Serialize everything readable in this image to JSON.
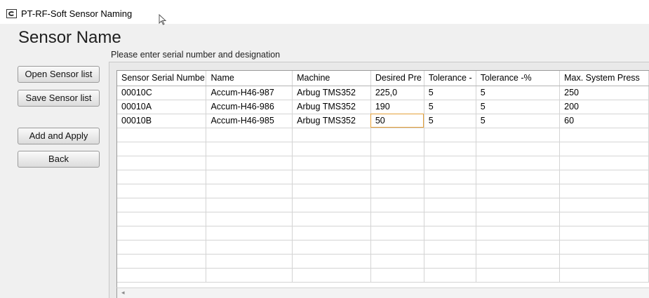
{
  "window": {
    "title": "PT-RF-Soft Sensor Naming",
    "icon": "sensor-app-icon"
  },
  "page": {
    "heading": "Sensor Name",
    "instruction": "Please enter serial number and designation"
  },
  "buttons": {
    "open": "Open Sensor list",
    "save": "Save Sensor list",
    "add_apply": "Add and Apply",
    "back": "Back"
  },
  "table": {
    "columns": [
      "Sensor Serial Numbe",
      "Name",
      "Machine",
      "Desired Pre",
      "Tolerance -",
      "Tolerance -%",
      "Max. System Press"
    ],
    "rows": [
      [
        "00010C",
        "Accum-H46-987",
        "Arbug TMS352",
        "225,0",
        "5",
        "5",
        "250"
      ],
      [
        "00010A",
        "Accum-H46-986",
        "Arbug TMS352",
        "190",
        "5",
        "5",
        "200"
      ],
      [
        "00010B",
        "Accum-H46-985",
        "Arbug TMS352",
        "50",
        "5",
        "5",
        "60"
      ],
      [
        "",
        "",
        "",
        "",
        "",
        "",
        ""
      ],
      [
        "",
        "",
        "",
        "",
        "",
        "",
        ""
      ],
      [
        "",
        "",
        "",
        "",
        "",
        "",
        ""
      ],
      [
        "",
        "",
        "",
        "",
        "",
        "",
        ""
      ],
      [
        "",
        "",
        "",
        "",
        "",
        "",
        ""
      ],
      [
        "",
        "",
        "",
        "",
        "",
        "",
        ""
      ],
      [
        "",
        "",
        "",
        "",
        "",
        "",
        ""
      ],
      [
        "",
        "",
        "",
        "",
        "",
        "",
        ""
      ],
      [
        "",
        "",
        "",
        "",
        "",
        "",
        ""
      ],
      [
        "",
        "",
        "",
        "",
        "",
        "",
        ""
      ],
      [
        "",
        "",
        "",
        "",
        "",
        "",
        ""
      ]
    ],
    "selected_cell": {
      "row": 2,
      "col": 3
    }
  },
  "colors": {
    "selection_outline": "#e5a13a",
    "background": "#f0f0f0"
  }
}
